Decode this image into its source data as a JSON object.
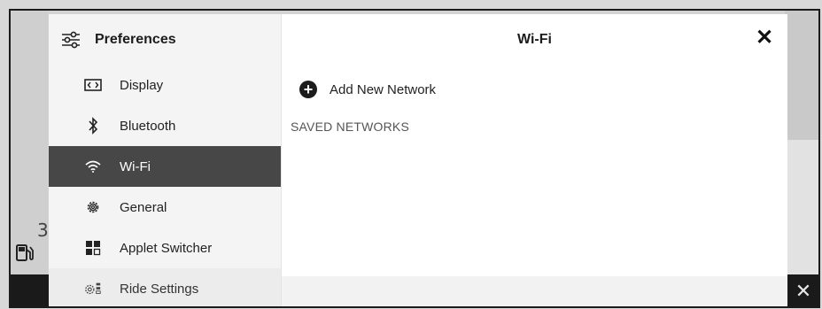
{
  "sidebar": {
    "title": "Preferences",
    "title_icon": "sliders-icon",
    "items": [
      {
        "label": "Display",
        "icon": "display-icon",
        "active": false
      },
      {
        "label": "Bluetooth",
        "icon": "bluetooth-icon",
        "active": false
      },
      {
        "label": "Wi-Fi",
        "icon": "wifi-icon",
        "active": true
      },
      {
        "label": "General",
        "icon": "gear-icon",
        "active": false
      },
      {
        "label": "Applet Switcher",
        "icon": "grid-icon",
        "active": false
      },
      {
        "label": "Ride Settings",
        "icon": "ride-settings-icon",
        "active": false
      }
    ]
  },
  "main": {
    "title": "Wi-Fi",
    "add_network_label": "Add New Network",
    "saved_networks_heading": "SAVED NETWORKS",
    "close_glyph": "✕"
  },
  "background": {
    "digit": "3",
    "close_glyph": "✕"
  },
  "colors": {
    "active_item_bg": "#474747",
    "sidebar_bg": "#f4f4f4",
    "bottom_bar": "#1a1a1a"
  }
}
